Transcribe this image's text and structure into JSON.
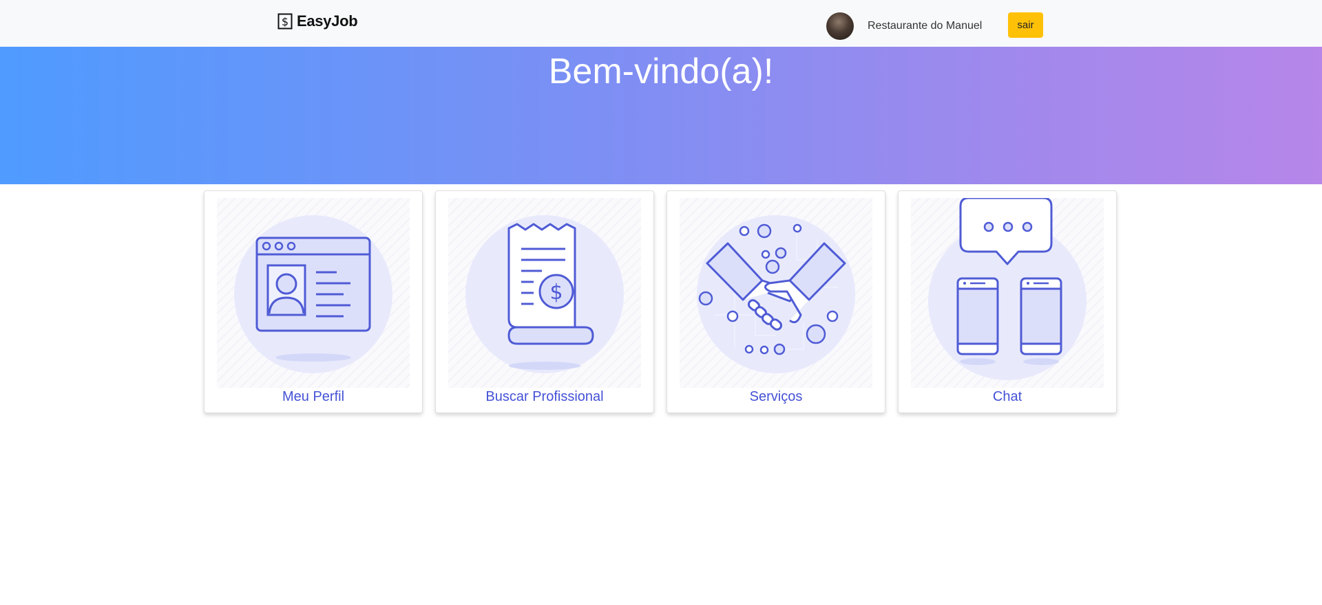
{
  "navbar": {
    "brand_name": "EasyJob",
    "user_name": "Restaurante do Manuel",
    "logout_label": "sair"
  },
  "hero": {
    "title": "Bem-vindo(a)!"
  },
  "cards": [
    {
      "label": "Meu Perfil",
      "icon": "profile-card-icon"
    },
    {
      "label": "Buscar Profissional",
      "icon": "receipt-dollar-icon"
    },
    {
      "label": "Serviços",
      "icon": "handshake-icon"
    },
    {
      "label": "Chat",
      "icon": "chat-phones-icon"
    }
  ],
  "colors": {
    "accent": "#4451d6",
    "icon_stroke": "#4f5bd5",
    "icon_fill": "#dcdffa",
    "button": "#ffc107",
    "hero_start": "#4f9bff",
    "hero_end": "#b686e9",
    "navbar_bg": "#f8f9fa"
  }
}
